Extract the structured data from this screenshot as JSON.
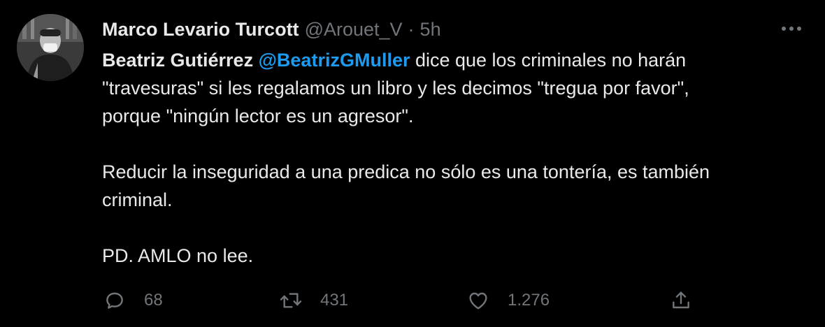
{
  "tweet": {
    "author_name": "Marco Levario Turcott",
    "author_handle": "@Arouet_V",
    "separator": "·",
    "time": "5h",
    "body": {
      "line1_bold": "Beatriz Gutiérrez",
      "line1_mention": "@BeatrizGMuller",
      "line1_rest": " dice que los criminales no harán",
      "line2": "\"travesuras\" si les regalamos un libro y les decimos \"tregua por favor\",",
      "line3": "porque \"ningún lector es un agresor\".",
      "para2_line1": "Reducir la inseguridad a una predica no sólo es una tontería, es también",
      "para2_line2": "criminal.",
      "para3": "PD. AMLO no lee."
    },
    "actions": {
      "replies": "68",
      "retweets": "431",
      "likes": "1.276"
    }
  },
  "icons": {
    "more": "more-icon",
    "reply": "reply-icon",
    "retweet": "retweet-icon",
    "like": "heart-icon",
    "share": "share-icon"
  },
  "colors": {
    "background": "#000000",
    "text": "#e7e9ea",
    "secondary": "#71767b",
    "mention": "#1d9bf0"
  }
}
